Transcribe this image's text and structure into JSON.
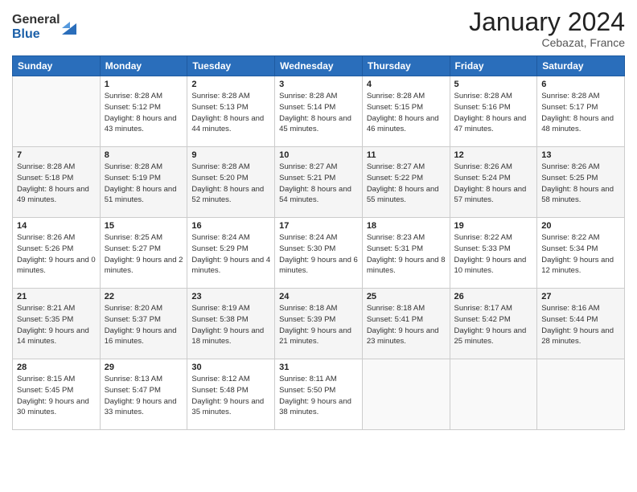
{
  "header": {
    "logo_general": "General",
    "logo_blue": "Blue",
    "title": "January 2024",
    "location": "Cebazat, France"
  },
  "days_of_week": [
    "Sunday",
    "Monday",
    "Tuesday",
    "Wednesday",
    "Thursday",
    "Friday",
    "Saturday"
  ],
  "weeks": [
    [
      {
        "day": "",
        "sunrise": "",
        "sunset": "",
        "daylight": ""
      },
      {
        "day": "1",
        "sunrise": "Sunrise: 8:28 AM",
        "sunset": "Sunset: 5:12 PM",
        "daylight": "Daylight: 8 hours and 43 minutes."
      },
      {
        "day": "2",
        "sunrise": "Sunrise: 8:28 AM",
        "sunset": "Sunset: 5:13 PM",
        "daylight": "Daylight: 8 hours and 44 minutes."
      },
      {
        "day": "3",
        "sunrise": "Sunrise: 8:28 AM",
        "sunset": "Sunset: 5:14 PM",
        "daylight": "Daylight: 8 hours and 45 minutes."
      },
      {
        "day": "4",
        "sunrise": "Sunrise: 8:28 AM",
        "sunset": "Sunset: 5:15 PM",
        "daylight": "Daylight: 8 hours and 46 minutes."
      },
      {
        "day": "5",
        "sunrise": "Sunrise: 8:28 AM",
        "sunset": "Sunset: 5:16 PM",
        "daylight": "Daylight: 8 hours and 47 minutes."
      },
      {
        "day": "6",
        "sunrise": "Sunrise: 8:28 AM",
        "sunset": "Sunset: 5:17 PM",
        "daylight": "Daylight: 8 hours and 48 minutes."
      }
    ],
    [
      {
        "day": "7",
        "sunrise": "Sunrise: 8:28 AM",
        "sunset": "Sunset: 5:18 PM",
        "daylight": "Daylight: 8 hours and 49 minutes."
      },
      {
        "day": "8",
        "sunrise": "Sunrise: 8:28 AM",
        "sunset": "Sunset: 5:19 PM",
        "daylight": "Daylight: 8 hours and 51 minutes."
      },
      {
        "day": "9",
        "sunrise": "Sunrise: 8:28 AM",
        "sunset": "Sunset: 5:20 PM",
        "daylight": "Daylight: 8 hours and 52 minutes."
      },
      {
        "day": "10",
        "sunrise": "Sunrise: 8:27 AM",
        "sunset": "Sunset: 5:21 PM",
        "daylight": "Daylight: 8 hours and 54 minutes."
      },
      {
        "day": "11",
        "sunrise": "Sunrise: 8:27 AM",
        "sunset": "Sunset: 5:22 PM",
        "daylight": "Daylight: 8 hours and 55 minutes."
      },
      {
        "day": "12",
        "sunrise": "Sunrise: 8:26 AM",
        "sunset": "Sunset: 5:24 PM",
        "daylight": "Daylight: 8 hours and 57 minutes."
      },
      {
        "day": "13",
        "sunrise": "Sunrise: 8:26 AM",
        "sunset": "Sunset: 5:25 PM",
        "daylight": "Daylight: 8 hours and 58 minutes."
      }
    ],
    [
      {
        "day": "14",
        "sunrise": "Sunrise: 8:26 AM",
        "sunset": "Sunset: 5:26 PM",
        "daylight": "Daylight: 9 hours and 0 minutes."
      },
      {
        "day": "15",
        "sunrise": "Sunrise: 8:25 AM",
        "sunset": "Sunset: 5:27 PM",
        "daylight": "Daylight: 9 hours and 2 minutes."
      },
      {
        "day": "16",
        "sunrise": "Sunrise: 8:24 AM",
        "sunset": "Sunset: 5:29 PM",
        "daylight": "Daylight: 9 hours and 4 minutes."
      },
      {
        "day": "17",
        "sunrise": "Sunrise: 8:24 AM",
        "sunset": "Sunset: 5:30 PM",
        "daylight": "Daylight: 9 hours and 6 minutes."
      },
      {
        "day": "18",
        "sunrise": "Sunrise: 8:23 AM",
        "sunset": "Sunset: 5:31 PM",
        "daylight": "Daylight: 9 hours and 8 minutes."
      },
      {
        "day": "19",
        "sunrise": "Sunrise: 8:22 AM",
        "sunset": "Sunset: 5:33 PM",
        "daylight": "Daylight: 9 hours and 10 minutes."
      },
      {
        "day": "20",
        "sunrise": "Sunrise: 8:22 AM",
        "sunset": "Sunset: 5:34 PM",
        "daylight": "Daylight: 9 hours and 12 minutes."
      }
    ],
    [
      {
        "day": "21",
        "sunrise": "Sunrise: 8:21 AM",
        "sunset": "Sunset: 5:35 PM",
        "daylight": "Daylight: 9 hours and 14 minutes."
      },
      {
        "day": "22",
        "sunrise": "Sunrise: 8:20 AM",
        "sunset": "Sunset: 5:37 PM",
        "daylight": "Daylight: 9 hours and 16 minutes."
      },
      {
        "day": "23",
        "sunrise": "Sunrise: 8:19 AM",
        "sunset": "Sunset: 5:38 PM",
        "daylight": "Daylight: 9 hours and 18 minutes."
      },
      {
        "day": "24",
        "sunrise": "Sunrise: 8:18 AM",
        "sunset": "Sunset: 5:39 PM",
        "daylight": "Daylight: 9 hours and 21 minutes."
      },
      {
        "day": "25",
        "sunrise": "Sunrise: 8:18 AM",
        "sunset": "Sunset: 5:41 PM",
        "daylight": "Daylight: 9 hours and 23 minutes."
      },
      {
        "day": "26",
        "sunrise": "Sunrise: 8:17 AM",
        "sunset": "Sunset: 5:42 PM",
        "daylight": "Daylight: 9 hours and 25 minutes."
      },
      {
        "day": "27",
        "sunrise": "Sunrise: 8:16 AM",
        "sunset": "Sunset: 5:44 PM",
        "daylight": "Daylight: 9 hours and 28 minutes."
      }
    ],
    [
      {
        "day": "28",
        "sunrise": "Sunrise: 8:15 AM",
        "sunset": "Sunset: 5:45 PM",
        "daylight": "Daylight: 9 hours and 30 minutes."
      },
      {
        "day": "29",
        "sunrise": "Sunrise: 8:13 AM",
        "sunset": "Sunset: 5:47 PM",
        "daylight": "Daylight: 9 hours and 33 minutes."
      },
      {
        "day": "30",
        "sunrise": "Sunrise: 8:12 AM",
        "sunset": "Sunset: 5:48 PM",
        "daylight": "Daylight: 9 hours and 35 minutes."
      },
      {
        "day": "31",
        "sunrise": "Sunrise: 8:11 AM",
        "sunset": "Sunset: 5:50 PM",
        "daylight": "Daylight: 9 hours and 38 minutes."
      },
      {
        "day": "",
        "sunrise": "",
        "sunset": "",
        "daylight": ""
      },
      {
        "day": "",
        "sunrise": "",
        "sunset": "",
        "daylight": ""
      },
      {
        "day": "",
        "sunrise": "",
        "sunset": "",
        "daylight": ""
      }
    ]
  ]
}
